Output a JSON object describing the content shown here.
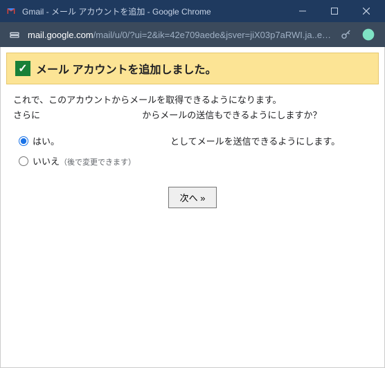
{
  "window": {
    "title": "Gmail - メール アカウントを追加 - Google Chrome"
  },
  "address": {
    "host": "mail.google.com",
    "path": "/mail/u/0/?ui=2&ik=42e709aede&jsver=jiX03p7aRWI.ja..e…"
  },
  "banner": {
    "text": "メール アカウントを追加しました。"
  },
  "intro": {
    "line1": "これで、このアカウントからメールを取得できるようになります。",
    "line2_pre": "さらに",
    "line2_post": "からメールの送信もできるようにしますか？"
  },
  "options": {
    "yes_pre": "はい。",
    "yes_post": "としてメールを送信できるようにします。",
    "no": "いいえ",
    "no_hint": "（後で変更できます）"
  },
  "buttons": {
    "next": "次へ »"
  }
}
